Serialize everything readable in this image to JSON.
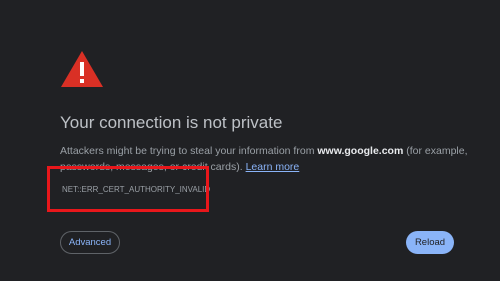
{
  "interstitial": {
    "icon": "warning-triangle-icon",
    "title": "Your connection is not private",
    "description_prefix": "Attackers might be trying to steal your information from ",
    "domain": "www.google.com",
    "description_suffix": " (for example, passwords, messages, or credit cards). ",
    "learn_more": "Learn more",
    "error_code": "NET::ERR_CERT_AUTHORITY_INVALID",
    "advanced_label": "Advanced",
    "reload_label": "Reload"
  },
  "colors": {
    "background": "#202124",
    "warning": "#d93025",
    "link": "#8ab4f8",
    "highlight_box": "#e8171b"
  }
}
